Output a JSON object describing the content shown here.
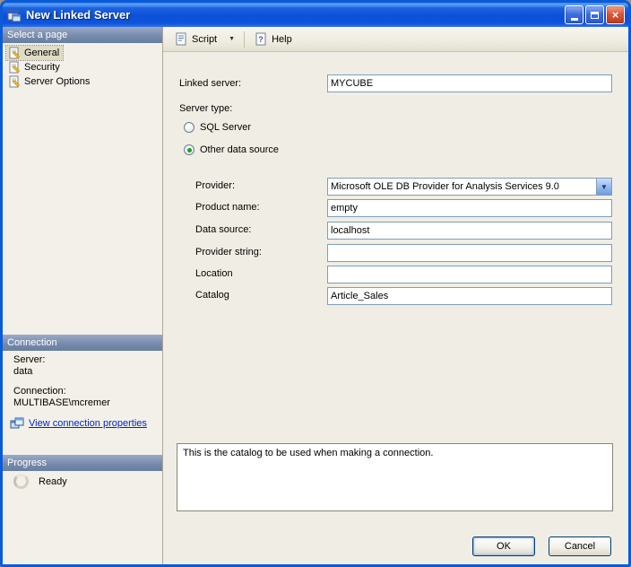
{
  "window": {
    "title": "New Linked Server"
  },
  "icons": {
    "close_glyph": "×",
    "dropdown_glyph": "▼"
  },
  "colors": {
    "titlebar_blue": "#0B50D8",
    "panel_header_slate": "#7589AB",
    "link_blue": "#0026C8",
    "radio_selected_green": "#1DA11D",
    "input_border": "#7F9DB9"
  },
  "sidebar": {
    "select_page_header": "Select a page",
    "pages": [
      {
        "label": "General"
      },
      {
        "label": "Security"
      },
      {
        "label": "Server Options"
      }
    ],
    "connection_header": "Connection",
    "server_label": "Server:",
    "server_value": "data",
    "connection_label": "Connection:",
    "connection_value": "MULTIBASE\\mcremer",
    "view_link_label": "View connection properties",
    "progress_header": "Progress",
    "progress_status": "Ready"
  },
  "toolbar": {
    "script_label": "Script",
    "help_label": "Help"
  },
  "form": {
    "linked_server_label": "Linked server:",
    "linked_server_value": "MYCUBE",
    "server_type_label": "Server type:",
    "radio_sql_label": "SQL Server",
    "radio_other_label": "Other data source",
    "provider_label": "Provider:",
    "provider_value": "Microsoft OLE DB Provider for Analysis Services 9.0",
    "product_name_label": "Product name:",
    "product_name_value": "empty",
    "data_source_label": "Data source:",
    "data_source_value": "localhost",
    "provider_string_label": "Provider string:",
    "provider_string_value": "",
    "location_label": "Location",
    "location_value": "",
    "catalog_label": "Catalog",
    "catalog_value": "Article_Sales",
    "help_text": "This is the catalog to be used when making a connection."
  },
  "footer": {
    "ok_label": "OK",
    "cancel_label": "Cancel"
  }
}
